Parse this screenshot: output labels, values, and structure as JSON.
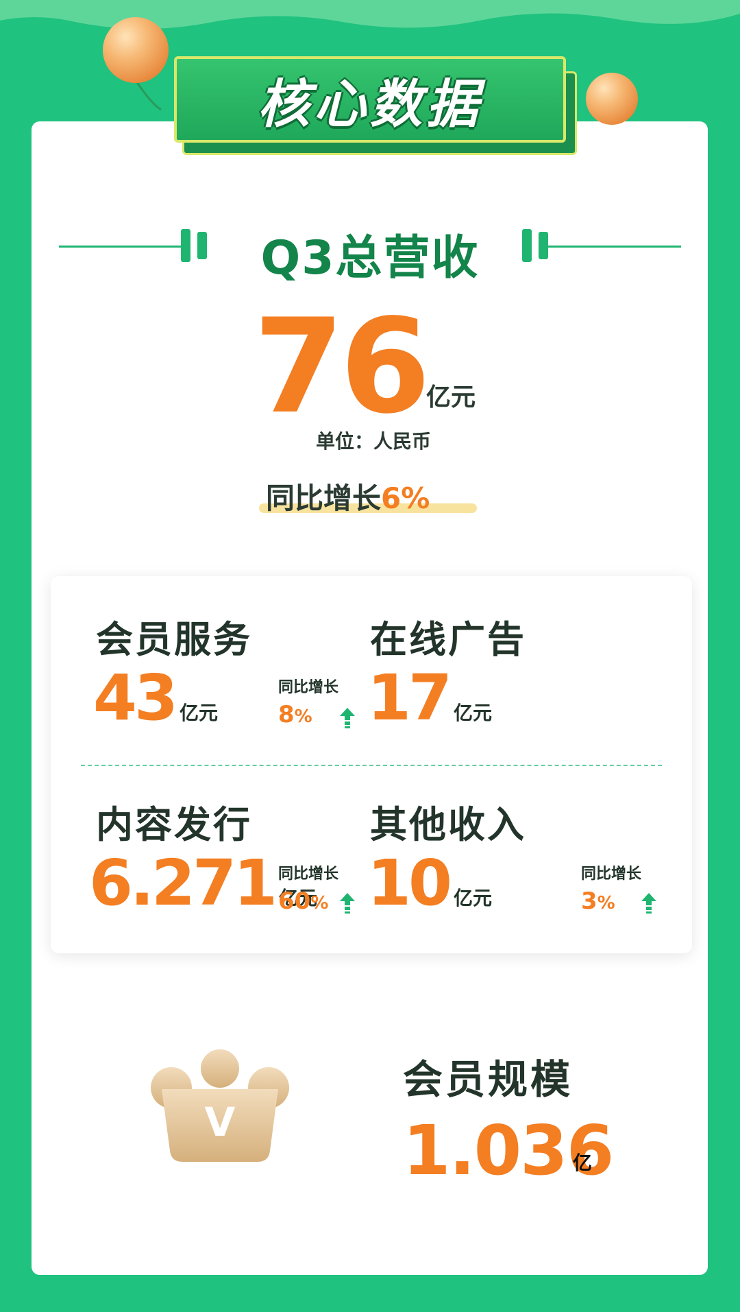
{
  "header": {
    "title": "核心数据"
  },
  "revenue": {
    "title": "Q3总营收",
    "value": "76",
    "unit": "亿元",
    "currency_note": "单位：人民币",
    "yoy_label": "同比增长",
    "yoy_value": "6%"
  },
  "segments": [
    {
      "title": "会员服务",
      "value": "43",
      "unit": "亿元",
      "yoy_label": "同比增长",
      "yoy_num": "8",
      "yoy_pct": "%"
    },
    {
      "title": "在线广告",
      "value": "17",
      "unit": "亿元"
    },
    {
      "title": "内容发行",
      "value": "6.271",
      "unit": "亿元",
      "yoy_label": "同比增长",
      "yoy_num": "60",
      "yoy_pct": "%"
    },
    {
      "title": "其他收入",
      "value": "10",
      "unit": "亿元",
      "yoy_label": "同比增长",
      "yoy_num": "3",
      "yoy_pct": "%"
    }
  ],
  "membership": {
    "title": "会员规模",
    "value": "1.036",
    "unit": "亿",
    "crown_letter": "V"
  },
  "colors": {
    "background": "#1fc27e",
    "accent": "#f47e22",
    "title_green": "#13844a",
    "dark_text": "#23352b"
  },
  "icons": [
    "balloon-icon",
    "up-arrow-icon",
    "crown-icon"
  ]
}
